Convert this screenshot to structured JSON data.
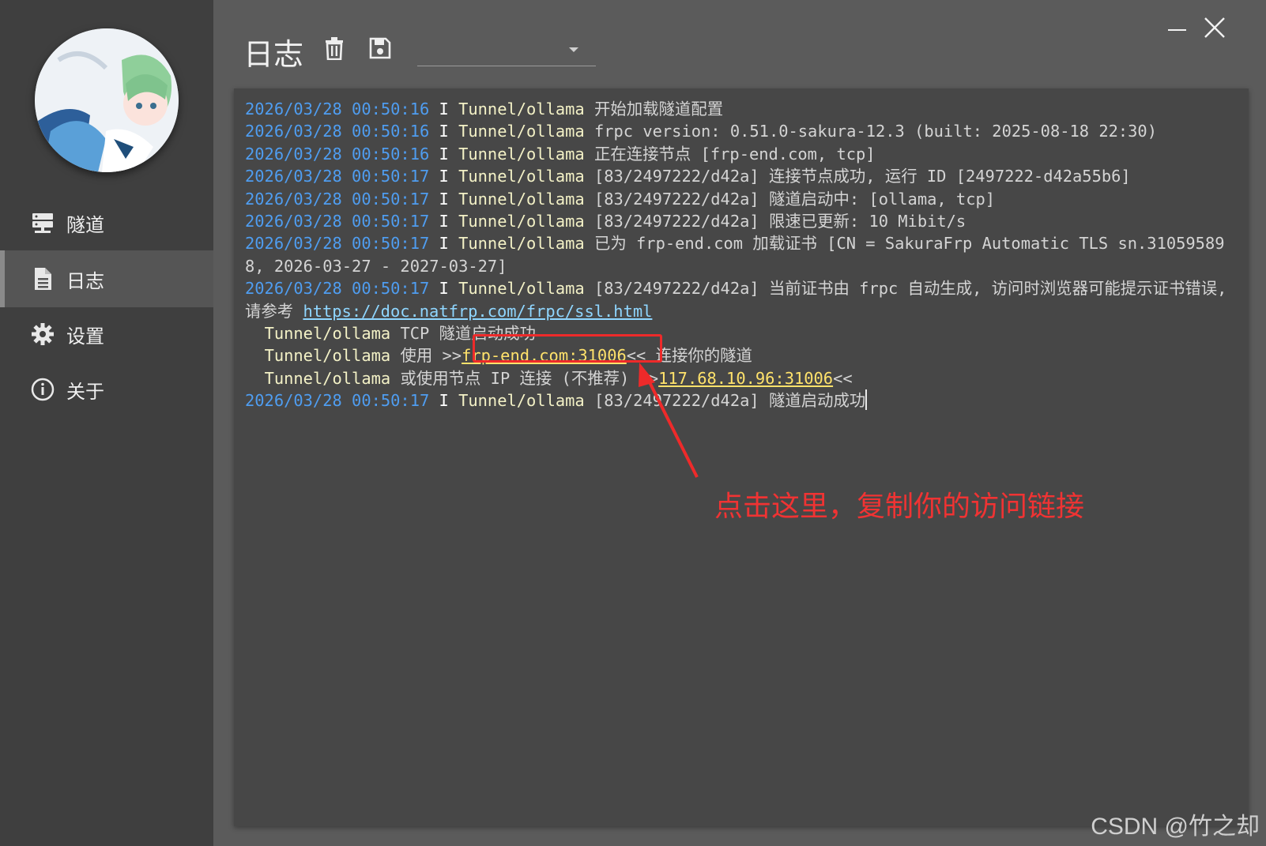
{
  "sidebar": {
    "avatar_name": "anime-avatar",
    "items": [
      {
        "label": "隧道",
        "icon": "server-icon",
        "active": false
      },
      {
        "label": "日志",
        "icon": "document-icon",
        "active": true
      },
      {
        "label": "设置",
        "icon": "gear-icon",
        "active": false
      },
      {
        "label": "关于",
        "icon": "info-icon",
        "active": false
      }
    ]
  },
  "header": {
    "title": "日志",
    "delete_icon": "trash-icon",
    "save_icon": "floppy-disk-icon",
    "filter_value": ""
  },
  "window": {
    "minimize_icon": "minimize-icon",
    "close_icon": "close-icon"
  },
  "log": {
    "lines": [
      {
        "ts": "2026/03/28 00:50:16",
        "lvl": "I",
        "tunnel": "Tunnel/ollama",
        "msg": "开始加载隧道配置"
      },
      {
        "ts": "2026/03/28 00:50:16",
        "lvl": "I",
        "tunnel": "Tunnel/ollama",
        "msg": "frpc version: 0.51.0-sakura-12.3 (built: 2025-08-18 22:30)"
      },
      {
        "ts": "2026/03/28 00:50:16",
        "lvl": "I",
        "tunnel": "Tunnel/ollama",
        "msg": "正在连接节点 [frp-end.com, tcp]"
      },
      {
        "ts": "2026/03/28 00:50:17",
        "lvl": "I",
        "tunnel": "Tunnel/ollama",
        "msg": "[83/2497222/d42a] 连接节点成功, 运行 ID [2497222-d42a55b6]"
      },
      {
        "ts": "2026/03/28 00:50:17",
        "lvl": "I",
        "tunnel": "Tunnel/ollama",
        "msg": "[83/2497222/d42a] 隧道启动中: [ollama, tcp]"
      },
      {
        "ts": "2026/03/28 00:50:17",
        "lvl": "I",
        "tunnel": "Tunnel/ollama",
        "msg": "[83/2497222/d42a] 限速已更新: 10 Mibit/s"
      },
      {
        "ts": "2026/03/28 00:50:17",
        "lvl": "I",
        "tunnel": "Tunnel/ollama",
        "msg": "已为 frp-end.com 加载证书 [CN = SakuraFrp Automatic TLS sn.310595898, 2026-03-27 - 2027-03-27]"
      },
      {
        "ts": "2026/03/28 00:50:17",
        "lvl": "I",
        "tunnel": "Tunnel/ollama",
        "msg": "[83/2497222/d42a] 当前证书由 frpc 自动生成, 访问时浏览器可能提示证书错误, 请参考 ",
        "link": "https://doc.natfrp.com/frpc/ssl.html"
      }
    ],
    "info_tcp": {
      "tunnel": "Tunnel/ollama",
      "msg": "TCP 隧道启动成功"
    },
    "info_use": {
      "tunnel": "Tunnel/ollama",
      "prefix": "使用 >>",
      "addr": "frp-end.com:31006",
      "suffix": "<< 连接你的隧道"
    },
    "info_ip": {
      "tunnel": "Tunnel/ollama",
      "prefix": "或使用节点 IP 连接 (不推荐) >>",
      "addr": "117.68.10.96:31006",
      "suffix": "<<"
    },
    "last": {
      "ts": "2026/03/28 00:50:17",
      "lvl": "I",
      "tunnel": "Tunnel/ollama",
      "msg": "[83/2497222/d42a] 隧道启动成功"
    }
  },
  "annotation": "点击这里，复制你的访问链接",
  "watermark": "CSDN @竹之却",
  "colors": {
    "timestamp": "#4f9df0",
    "tunnel": "#f3f1c6",
    "address": "#ffe26b",
    "annotation": "#f03333"
  }
}
